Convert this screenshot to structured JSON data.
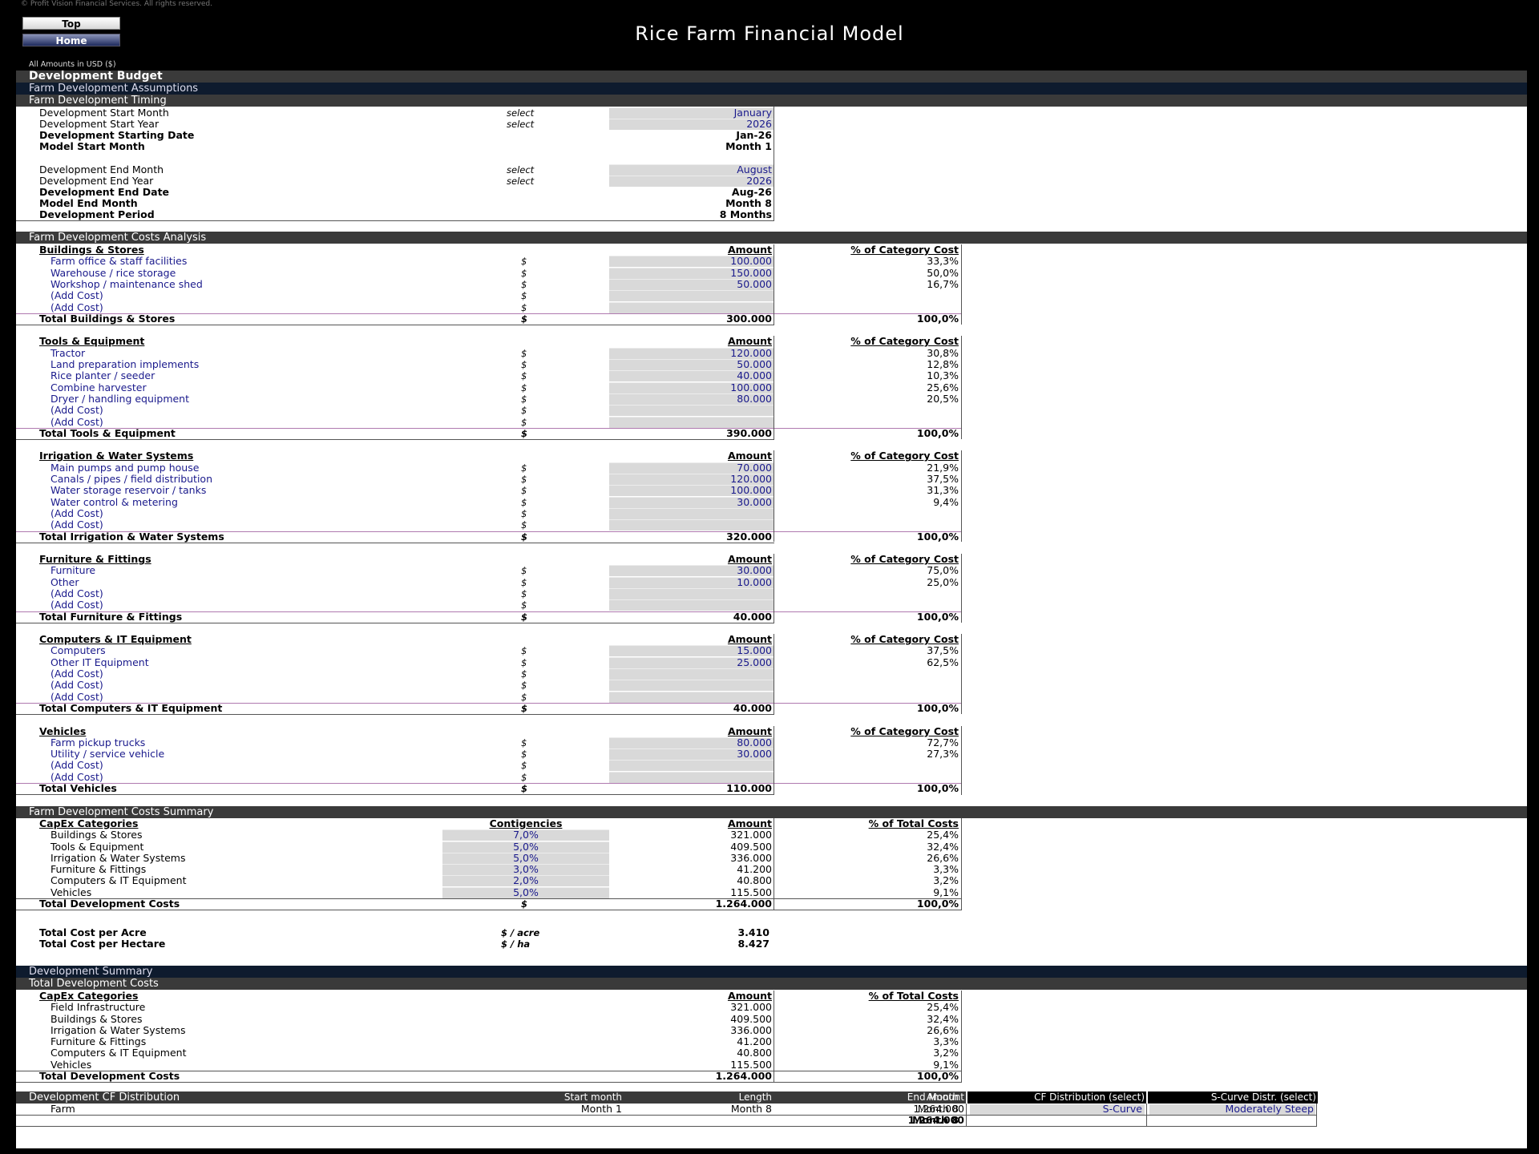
{
  "header": {
    "copyright": "© Profit Vision Financial Services. All rights reserved.",
    "top_button": "Top",
    "home_button": "Home",
    "title": "Rice Farm Financial Model",
    "units": "All Amounts in  USD ($)"
  },
  "sections": {
    "dev_budget": "Development Budget",
    "assumptions": "Farm Development Assumptions",
    "timing": "Farm Development Timing",
    "costs_analysis": "Farm Development Costs Analysis",
    "costs_summary": "Farm Development Costs Summary",
    "dev_summary": "Development Summary",
    "total_dev_costs": "Total Development Costs",
    "cf_distribution": "Development CF Distribution"
  },
  "timing": {
    "start_month_label": "Development Start Month",
    "start_month_sel": "select",
    "start_month": "January",
    "start_year_label": "Development Start Year",
    "start_year_sel": "select",
    "start_year": "2026",
    "start_date_label": "Development Starting Date",
    "start_date": "Jan-26",
    "model_start_label": "Model Start Month",
    "model_start": "Month 1",
    "end_month_label": "Development End Month",
    "end_month_sel": "select",
    "end_month": "August",
    "end_year_label": "Development End Year",
    "end_year_sel": "select",
    "end_year": "2026",
    "end_date_label": "Development End Date",
    "end_date": "Aug-26",
    "model_end_label": "Model End Month",
    "model_end": "Month 8",
    "period_label": "Development Period",
    "period": "8 Months"
  },
  "columns": {
    "amount": "Amount",
    "pct_category": "% of Category Cost",
    "pct_total": "% of Total Costs",
    "currency": "$",
    "contingencies": "Contigencies",
    "capex": "CapEx Categories"
  },
  "categories": [
    {
      "title": "Buildings & Stores",
      "items": [
        {
          "label": "Farm office & staff facilities",
          "amount": "100.000",
          "pct": "33,3%"
        },
        {
          "label": "Warehouse / rice storage",
          "amount": "150.000",
          "pct": "50,0%"
        },
        {
          "label": "Workshop / maintenance shed",
          "amount": "50.000",
          "pct": "16,7%"
        },
        {
          "label": "(Add Cost)",
          "amount": "",
          "pct": ""
        },
        {
          "label": "(Add Cost)",
          "amount": "",
          "pct": ""
        }
      ],
      "total_label": "Total Buildings & Stores",
      "total": "300.000",
      "total_pct": "100,0%"
    },
    {
      "title": "Tools & Equipment",
      "items": [
        {
          "label": "Tractor",
          "amount": "120.000",
          "pct": "30,8%"
        },
        {
          "label": "Land preparation implements",
          "amount": "50.000",
          "pct": "12,8%"
        },
        {
          "label": "Rice planter / seeder",
          "amount": "40.000",
          "pct": "10,3%"
        },
        {
          "label": "Combine harvester",
          "amount": "100.000",
          "pct": "25,6%"
        },
        {
          "label": "Dryer / handling equipment",
          "amount": "80.000",
          "pct": "20,5%"
        },
        {
          "label": "(Add Cost)",
          "amount": "",
          "pct": ""
        },
        {
          "label": "(Add Cost)",
          "amount": "",
          "pct": ""
        }
      ],
      "total_label": "Total Tools & Equipment",
      "total": "390.000",
      "total_pct": "100,0%"
    },
    {
      "title": "Irrigation & Water Systems",
      "items": [
        {
          "label": "Main pumps and pump house",
          "amount": "70.000",
          "pct": "21,9%"
        },
        {
          "label": "Canals / pipes / field distribution",
          "amount": "120.000",
          "pct": "37,5%"
        },
        {
          "label": "Water storage reservoir / tanks",
          "amount": "100.000",
          "pct": "31,3%"
        },
        {
          "label": "Water control & metering",
          "amount": "30.000",
          "pct": "9,4%"
        },
        {
          "label": "(Add Cost)",
          "amount": "",
          "pct": ""
        },
        {
          "label": "(Add Cost)",
          "amount": "",
          "pct": ""
        }
      ],
      "total_label": "Total Irrigation & Water Systems",
      "total": "320.000",
      "total_pct": "100,0%"
    },
    {
      "title": "Furniture & Fittings",
      "items": [
        {
          "label": "Furniture",
          "amount": "30.000",
          "pct": "75,0%"
        },
        {
          "label": "Other",
          "amount": "10.000",
          "pct": "25,0%"
        },
        {
          "label": "(Add Cost)",
          "amount": "",
          "pct": ""
        },
        {
          "label": "(Add Cost)",
          "amount": "",
          "pct": ""
        }
      ],
      "total_label": "Total Furniture & Fittings",
      "total": "40.000",
      "total_pct": "100,0%"
    },
    {
      "title": "Computers & IT Equipment",
      "items": [
        {
          "label": "Computers",
          "amount": "15.000",
          "pct": "37,5%"
        },
        {
          "label": "Other IT Equipment",
          "amount": "25.000",
          "pct": "62,5%"
        },
        {
          "label": "(Add Cost)",
          "amount": "",
          "pct": ""
        },
        {
          "label": "(Add Cost)",
          "amount": "",
          "pct": ""
        },
        {
          "label": "(Add Cost)",
          "amount": "",
          "pct": ""
        }
      ],
      "total_label": "Total Computers & IT Equipment",
      "total": "40.000",
      "total_pct": "100,0%"
    },
    {
      "title": "Vehicles",
      "items": [
        {
          "label": "Farm pickup trucks",
          "amount": "80.000",
          "pct": "72,7%"
        },
        {
          "label": "Utility / service vehicle",
          "amount": "30.000",
          "pct": "27,3%"
        },
        {
          "label": "(Add Cost)",
          "amount": "",
          "pct": ""
        },
        {
          "label": "(Add Cost)",
          "amount": "",
          "pct": ""
        }
      ],
      "total_label": "Total Vehicles",
      "total": "110.000",
      "total_pct": "100,0%"
    }
  ],
  "summary": {
    "rows": [
      {
        "label": "Buildings & Stores",
        "cont": "7,0%",
        "amount": "321.000",
        "pct": "25,4%"
      },
      {
        "label": "Tools & Equipment",
        "cont": "5,0%",
        "amount": "409.500",
        "pct": "32,4%"
      },
      {
        "label": "Irrigation & Water Systems",
        "cont": "5,0%",
        "amount": "336.000",
        "pct": "26,6%"
      },
      {
        "label": "Furniture & Fittings",
        "cont": "3,0%",
        "amount": "41.200",
        "pct": "3,3%"
      },
      {
        "label": "Computers & IT Equipment",
        "cont": "2,0%",
        "amount": "40.800",
        "pct": "3,2%"
      },
      {
        "label": "Vehicles",
        "cont": "5,0%",
        "amount": "115.500",
        "pct": "9,1%"
      }
    ],
    "total_label": "Total Development Costs",
    "total": "1.264.000",
    "total_pct": "100,0%",
    "per_acre_label": "Total Cost per Acre",
    "per_acre_unit": "$ / acre",
    "per_acre": "3.410",
    "per_ha_label": "Total Cost per Hectare",
    "per_ha_unit": "$ / ha",
    "per_ha": "8.427"
  },
  "dev_summary": {
    "rows": [
      {
        "label": "Field Infrastructure",
        "amount": "321.000",
        "pct": "25,4%"
      },
      {
        "label": "Buildings & Stores",
        "amount": "409.500",
        "pct": "32,4%"
      },
      {
        "label": "Irrigation & Water Systems",
        "amount": "336.000",
        "pct": "26,6%"
      },
      {
        "label": "Furniture & Fittings",
        "amount": "41.200",
        "pct": "3,3%"
      },
      {
        "label": "Computers & IT Equipment",
        "amount": "40.800",
        "pct": "3,2%"
      },
      {
        "label": "Vehicles",
        "amount": "115.500",
        "pct": "9,1%"
      }
    ],
    "total_label": "Total Development Costs",
    "total": "1.264.000",
    "total_pct": "100,0%"
  },
  "cf": {
    "start_hdr": "Start month",
    "length_hdr": "Length",
    "end_hdr": "End Month",
    "amount_hdr": "Amount",
    "dist_hdr": "CF Distribution (select)",
    "scurve_hdr": "S-Curve Distr. (select)",
    "row_label": "Farm",
    "start": "Month 1",
    "length": "Month 8",
    "end": "Month 8",
    "amount": "1.264.000",
    "dist": "S-Curve",
    "scurve": "Moderately Steep",
    "total_end": "Month 8",
    "total_amount": "1.264.000"
  },
  "colors": {
    "input_fill": "#d9d9d9",
    "input_text": "#1a1a8c",
    "header_dark": "#3a3a3a",
    "header_blue": "#0e1b2e"
  }
}
